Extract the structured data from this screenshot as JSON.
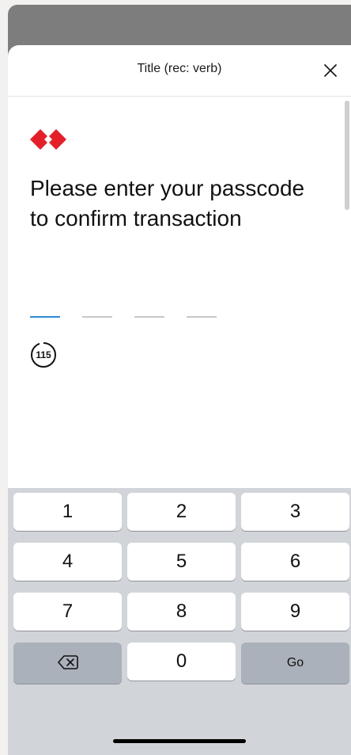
{
  "header": {
    "title": "Title (rec: verb)",
    "close_icon": "close-icon"
  },
  "brand": {
    "logo_icon": "diamond-logo-icon",
    "logo_color": "#e3202a"
  },
  "content": {
    "heading": "Please enter your passcode to confirm transaction"
  },
  "passcode": {
    "digits_total": 4,
    "digits_entered": 0,
    "active_color": "#2c8bd8"
  },
  "timer": {
    "value": "115"
  },
  "keyboard": {
    "keys": [
      "1",
      "2",
      "3",
      "4",
      "5",
      "6",
      "7",
      "8",
      "9",
      "0"
    ],
    "backspace_icon": "backspace-icon",
    "go_label": "Go"
  }
}
